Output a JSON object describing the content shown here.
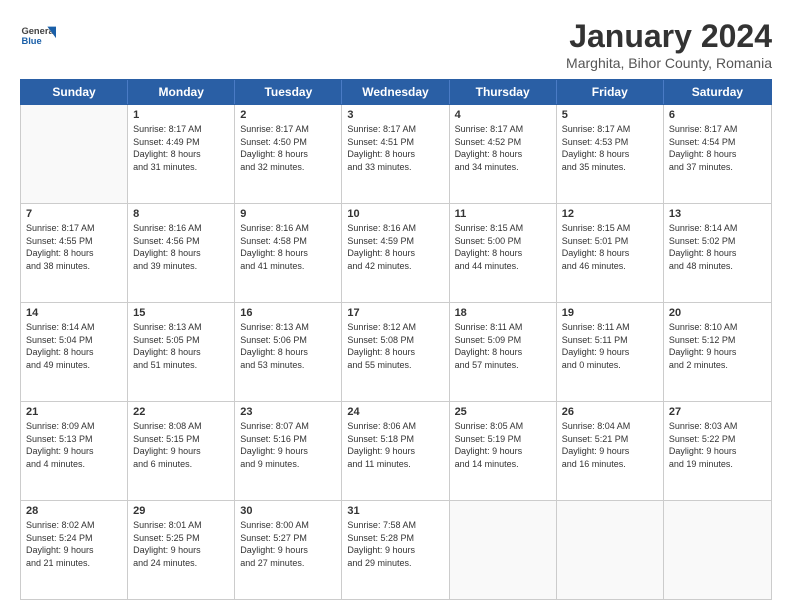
{
  "header": {
    "logo_general": "General",
    "logo_blue": "Blue",
    "title": "January 2024",
    "subtitle": "Marghita, Bihor County, Romania"
  },
  "calendar": {
    "days_of_week": [
      "Sunday",
      "Monday",
      "Tuesday",
      "Wednesday",
      "Thursday",
      "Friday",
      "Saturday"
    ],
    "weeks": [
      [
        {
          "day": "",
          "text": ""
        },
        {
          "day": "1",
          "text": "Sunrise: 8:17 AM\nSunset: 4:49 PM\nDaylight: 8 hours\nand 31 minutes."
        },
        {
          "day": "2",
          "text": "Sunrise: 8:17 AM\nSunset: 4:50 PM\nDaylight: 8 hours\nand 32 minutes."
        },
        {
          "day": "3",
          "text": "Sunrise: 8:17 AM\nSunset: 4:51 PM\nDaylight: 8 hours\nand 33 minutes."
        },
        {
          "day": "4",
          "text": "Sunrise: 8:17 AM\nSunset: 4:52 PM\nDaylight: 8 hours\nand 34 minutes."
        },
        {
          "day": "5",
          "text": "Sunrise: 8:17 AM\nSunset: 4:53 PM\nDaylight: 8 hours\nand 35 minutes."
        },
        {
          "day": "6",
          "text": "Sunrise: 8:17 AM\nSunset: 4:54 PM\nDaylight: 8 hours\nand 37 minutes."
        }
      ],
      [
        {
          "day": "7",
          "text": "Sunrise: 8:17 AM\nSunset: 4:55 PM\nDaylight: 8 hours\nand 38 minutes."
        },
        {
          "day": "8",
          "text": "Sunrise: 8:16 AM\nSunset: 4:56 PM\nDaylight: 8 hours\nand 39 minutes."
        },
        {
          "day": "9",
          "text": "Sunrise: 8:16 AM\nSunset: 4:58 PM\nDaylight: 8 hours\nand 41 minutes."
        },
        {
          "day": "10",
          "text": "Sunrise: 8:16 AM\nSunset: 4:59 PM\nDaylight: 8 hours\nand 42 minutes."
        },
        {
          "day": "11",
          "text": "Sunrise: 8:15 AM\nSunset: 5:00 PM\nDaylight: 8 hours\nand 44 minutes."
        },
        {
          "day": "12",
          "text": "Sunrise: 8:15 AM\nSunset: 5:01 PM\nDaylight: 8 hours\nand 46 minutes."
        },
        {
          "day": "13",
          "text": "Sunrise: 8:14 AM\nSunset: 5:02 PM\nDaylight: 8 hours\nand 48 minutes."
        }
      ],
      [
        {
          "day": "14",
          "text": "Sunrise: 8:14 AM\nSunset: 5:04 PM\nDaylight: 8 hours\nand 49 minutes."
        },
        {
          "day": "15",
          "text": "Sunrise: 8:13 AM\nSunset: 5:05 PM\nDaylight: 8 hours\nand 51 minutes."
        },
        {
          "day": "16",
          "text": "Sunrise: 8:13 AM\nSunset: 5:06 PM\nDaylight: 8 hours\nand 53 minutes."
        },
        {
          "day": "17",
          "text": "Sunrise: 8:12 AM\nSunset: 5:08 PM\nDaylight: 8 hours\nand 55 minutes."
        },
        {
          "day": "18",
          "text": "Sunrise: 8:11 AM\nSunset: 5:09 PM\nDaylight: 8 hours\nand 57 minutes."
        },
        {
          "day": "19",
          "text": "Sunrise: 8:11 AM\nSunset: 5:11 PM\nDaylight: 9 hours\nand 0 minutes."
        },
        {
          "day": "20",
          "text": "Sunrise: 8:10 AM\nSunset: 5:12 PM\nDaylight: 9 hours\nand 2 minutes."
        }
      ],
      [
        {
          "day": "21",
          "text": "Sunrise: 8:09 AM\nSunset: 5:13 PM\nDaylight: 9 hours\nand 4 minutes."
        },
        {
          "day": "22",
          "text": "Sunrise: 8:08 AM\nSunset: 5:15 PM\nDaylight: 9 hours\nand 6 minutes."
        },
        {
          "day": "23",
          "text": "Sunrise: 8:07 AM\nSunset: 5:16 PM\nDaylight: 9 hours\nand 9 minutes."
        },
        {
          "day": "24",
          "text": "Sunrise: 8:06 AM\nSunset: 5:18 PM\nDaylight: 9 hours\nand 11 minutes."
        },
        {
          "day": "25",
          "text": "Sunrise: 8:05 AM\nSunset: 5:19 PM\nDaylight: 9 hours\nand 14 minutes."
        },
        {
          "day": "26",
          "text": "Sunrise: 8:04 AM\nSunset: 5:21 PM\nDaylight: 9 hours\nand 16 minutes."
        },
        {
          "day": "27",
          "text": "Sunrise: 8:03 AM\nSunset: 5:22 PM\nDaylight: 9 hours\nand 19 minutes."
        }
      ],
      [
        {
          "day": "28",
          "text": "Sunrise: 8:02 AM\nSunset: 5:24 PM\nDaylight: 9 hours\nand 21 minutes."
        },
        {
          "day": "29",
          "text": "Sunrise: 8:01 AM\nSunset: 5:25 PM\nDaylight: 9 hours\nand 24 minutes."
        },
        {
          "day": "30",
          "text": "Sunrise: 8:00 AM\nSunset: 5:27 PM\nDaylight: 9 hours\nand 27 minutes."
        },
        {
          "day": "31",
          "text": "Sunrise: 7:58 AM\nSunset: 5:28 PM\nDaylight: 9 hours\nand 29 minutes."
        },
        {
          "day": "",
          "text": ""
        },
        {
          "day": "",
          "text": ""
        },
        {
          "day": "",
          "text": ""
        }
      ]
    ]
  }
}
